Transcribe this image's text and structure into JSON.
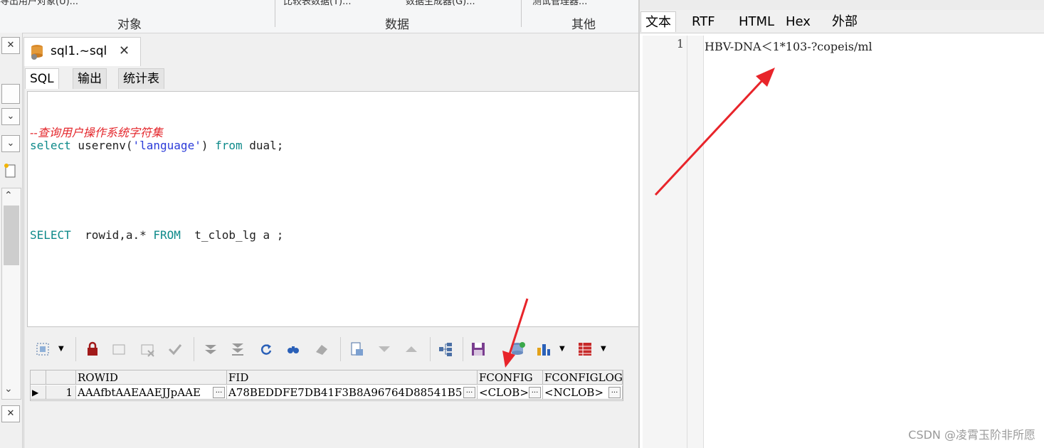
{
  "ribbon": {
    "groups": [
      "对象",
      "数据",
      "其他"
    ],
    "cut_items": [
      "导出用户对象(U)...",
      "比较表数据(T)...",
      "数据生成器(G)...",
      "测试管理器..."
    ]
  },
  "doc_tab": {
    "title": "sql1.~sql",
    "close": "✕"
  },
  "subtabs": [
    "SQL",
    "输出",
    "统计表"
  ],
  "editor": {
    "comment": "--查询用户操作系统字符集",
    "line1": {
      "kw1": "select",
      "fn": " userenv(",
      "str": "'language'",
      "rest": ")",
      "kw2": " from",
      "tail": " dual;"
    },
    "line2": {
      "kw1": "SELECT",
      "mid": "  rowid,a.* ",
      "kw2": "FROM",
      "tail": "  t_clob_lg a ;"
    }
  },
  "grid": {
    "columns": [
      "",
      "ROWID",
      "FID",
      "FCONFIG",
      "FCONFIGLOG"
    ],
    "rows": [
      {
        "num": "1",
        "rowid": "AAAfbtAAEAAEJJpAAE",
        "fid": "A78BEDDFE7DB41F3B8A96764D88541B5",
        "fconfig": "<CLOB>",
        "fconfiglog": "<NCLOB>"
      }
    ],
    "ellipsis": "..."
  },
  "right_pane": {
    "tabs": [
      "文本",
      "RTF",
      "HTML",
      "Hex",
      "外部"
    ],
    "line_number": "1",
    "content": "HBV-DNA＜1*103-?copeis/ml"
  },
  "watermark": "CSDN @凌霄玉阶非所愿",
  "colors": {
    "arrow": "#e8242a",
    "keyword": "#0e8a8a",
    "string": "#2b3bd9",
    "comment": "#e4262b"
  }
}
